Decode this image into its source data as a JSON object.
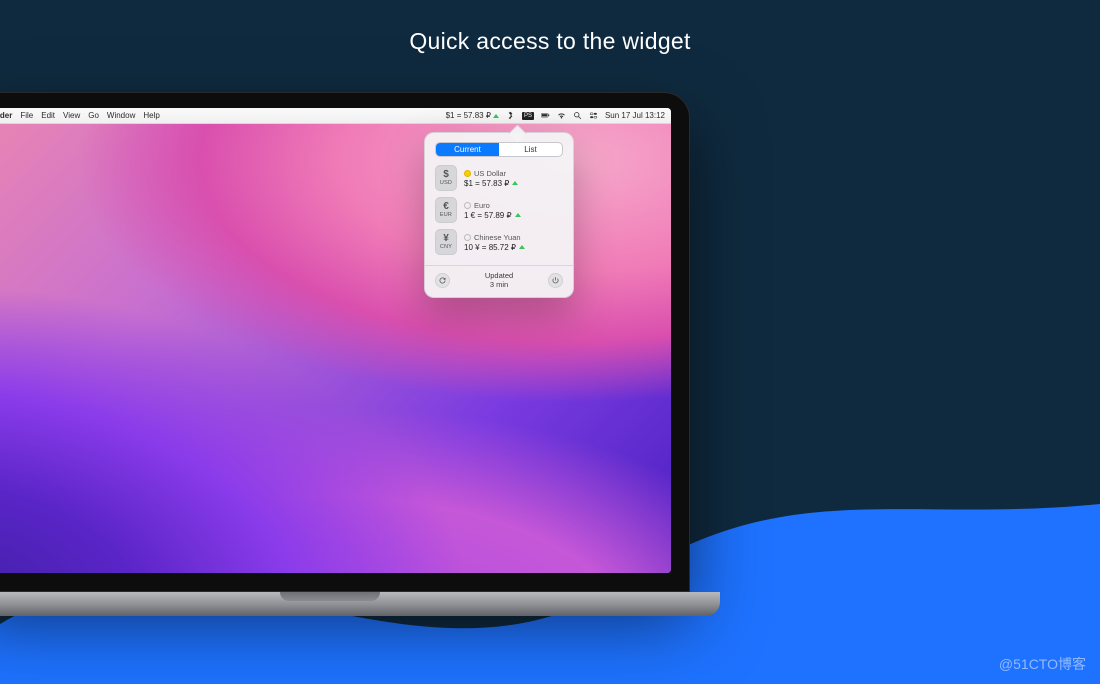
{
  "headline": "Quick access to the widget",
  "menubar": {
    "app": "nder",
    "items": [
      "File",
      "Edit",
      "View",
      "Go",
      "Window",
      "Help"
    ],
    "rate_chip": "$1 = 57.83 ₽",
    "badge": "PS",
    "clock": "Sun 17 Jul  13:12"
  },
  "popover": {
    "tabs": {
      "current": "Current",
      "list": "List"
    },
    "rows": [
      {
        "symbol": "$",
        "code": "USD",
        "name": "US Dollar",
        "value": "$1 = 57.83 ₽",
        "selected": true
      },
      {
        "symbol": "€",
        "code": "EUR",
        "name": "Euro",
        "value": "1 € = 57.89 ₽",
        "selected": false
      },
      {
        "symbol": "¥",
        "code": "CNY",
        "name": "Chinese Yuan",
        "value": "10 ¥ = 85.72 ₽",
        "selected": false
      }
    ],
    "updated_label": "Updated",
    "updated_value": "3 min"
  },
  "watermark": "@51CTO博客"
}
